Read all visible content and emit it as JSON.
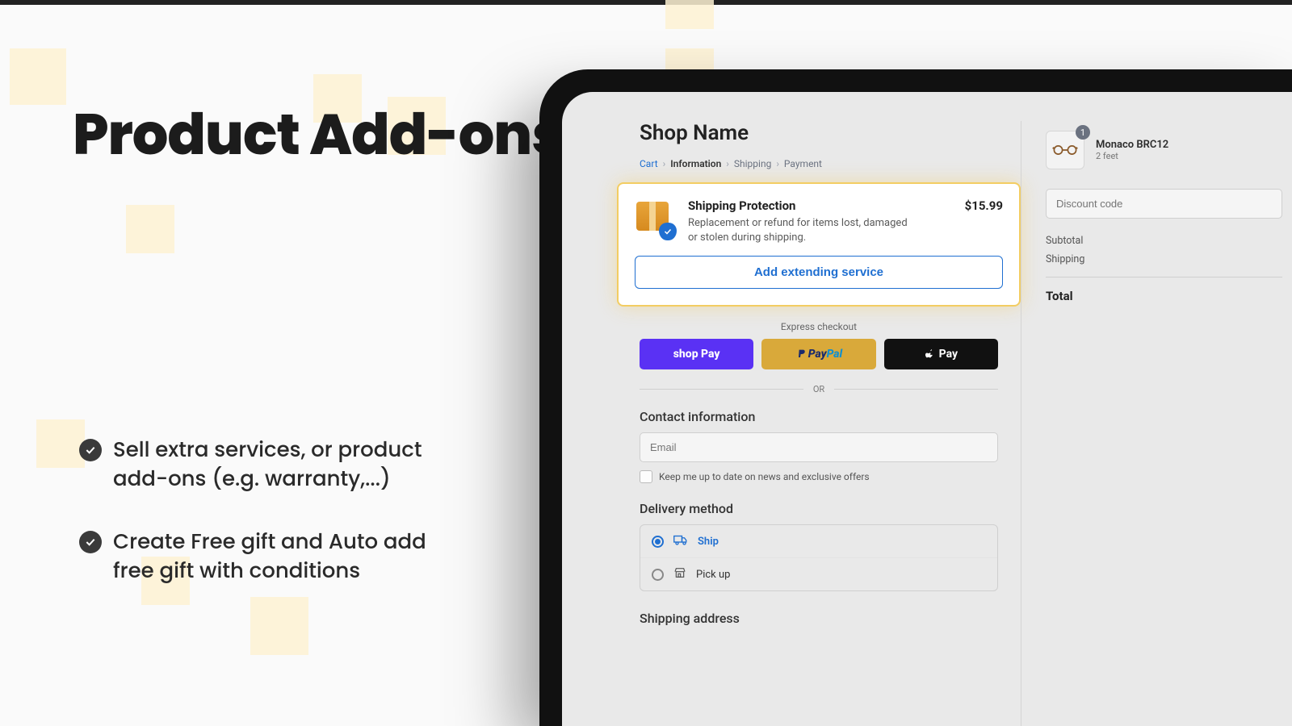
{
  "hero": {
    "title": "Product Add-ons",
    "bullets": [
      "Sell extra services, or product add-ons (e.g. warranty,...)",
      "Create Free gift and Auto add free gift with conditions"
    ]
  },
  "checkout": {
    "shop_name": "Shop Name",
    "breadcrumbs": {
      "cart": "Cart",
      "information": "Information",
      "shipping": "Shipping",
      "payment": "Payment"
    },
    "addon": {
      "title": "Shipping Protection",
      "desc": "Replacement or refund for items lost, damaged or stolen during shipping.",
      "price": "$15.99",
      "button": "Add extending service"
    },
    "express": {
      "label": "Express checkout",
      "shoppay": "shop Pay",
      "paypal_p": "Pay",
      "paypal_pal": "Pal",
      "applepay": "Pay"
    },
    "or": "OR",
    "contact": {
      "heading": "Contact information",
      "email_placeholder": "Email",
      "newsletter": "Keep me up to date on news and exclusive offers"
    },
    "delivery": {
      "heading": "Delivery method",
      "ship": "Ship",
      "pickup": "Pick up"
    },
    "shipping_address_heading": "Shipping address"
  },
  "sidebar": {
    "item": {
      "name": "Monaco BRC12",
      "variant": "2 feet",
      "qty": "1"
    },
    "discount_placeholder": "Discount code",
    "subtotal_label": "Subtotal",
    "shipping_label": "Shipping",
    "total_label": "Total"
  }
}
